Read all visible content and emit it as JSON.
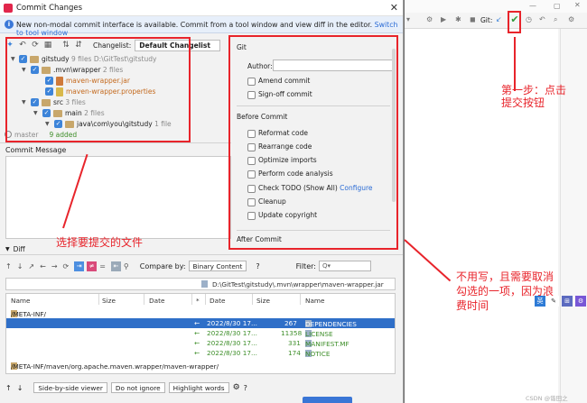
{
  "window": {
    "title": "Commit Changes",
    "close": "✕"
  },
  "banner": {
    "message": "New non-modal commit interface is available. Commit from a tool window and view diff in the editor.",
    "link": "Switch to tool window"
  },
  "toolbar": {
    "changelist_label": "Changelist:",
    "changelist_value": "Default Changelist"
  },
  "tree": [
    {
      "name": "gitstudy",
      "meta": "9 files  D:\\GitTest\\gitstudy"
    },
    {
      "name": ".mvn\\wrapper",
      "meta": "2 files"
    },
    {
      "name": "maven-wrapper.jar",
      "meta": ""
    },
    {
      "name": "maven-wrapper.properties",
      "meta": ""
    },
    {
      "name": "src",
      "meta": "3 files"
    },
    {
      "name": "main",
      "meta": "2 files"
    },
    {
      "name": "java\\com\\you\\gitstudy",
      "meta": "1 file"
    }
  ],
  "status": {
    "branch": "master",
    "added": "9 added"
  },
  "commit_message": {
    "label": "Commit Message",
    "value": ""
  },
  "git_panel": {
    "title": "Git",
    "author_label": "Author:",
    "author_value": "",
    "amend": "Amend commit",
    "signoff": "Sign-off commit",
    "before_commit": "Before Commit",
    "reformat": "Reformat code",
    "rearrange": "Rearrange code",
    "optimize": "Optimize imports",
    "analysis": "Perform code analysis",
    "todo": "Check TODO (Show All)",
    "todo_link": "Configure",
    "cleanup": "Cleanup",
    "copyright": "Update copyright",
    "after_commit": "After Commit"
  },
  "diff": {
    "label": "Diff",
    "compare_label": "Compare by:",
    "compare_value": "Binary Content",
    "help": "?",
    "filter_label": "Filter:",
    "filter_placeholder": "Q▾",
    "path": "D:\\GitTest\\gitstudy\\.mvn\\wrapper\\maven-wrapper.jar",
    "headers": {
      "name": "Name",
      "size": "Size",
      "date": "Date",
      "star": "*",
      "date2": "Date",
      "size2": "Size",
      "name2": "Name"
    },
    "folder1": "/META-INF/",
    "rows": [
      {
        "date": "2022/8/30 17...",
        "size": "267",
        "name": "DEPENDENCIES"
      },
      {
        "date": "2022/8/30 17...",
        "size": "11358",
        "name": "LICENSE"
      },
      {
        "date": "2022/8/30 17...",
        "size": "331",
        "name": "MANIFEST.MF"
      },
      {
        "date": "2022/8/30 17...",
        "size": "174",
        "name": "NOTICE"
      }
    ],
    "folder2": "/META-INF/maven/org.apache.maven.wrapper/maven-wrapper/"
  },
  "bottom": {
    "viewer": "Side-by-side viewer",
    "ignore": "Do not ignore",
    "highlight": "Highlight words",
    "help": "?"
  },
  "ide": {
    "git_label": "Git:"
  },
  "annotations": {
    "step1_line1": "第一步：点击",
    "step1_line2": "提交按钮",
    "select_files": "选择要提交的文件",
    "note_line1": "不用写，且需要取消",
    "note_line2": "勾选的一项，因为浪",
    "note_line3": "费时间"
  },
  "watermark": "CSDN @谐田之",
  "colors": {
    "accent": "#3d84d9",
    "annotation": "#e8242b",
    "added": "#3f8f2b"
  }
}
